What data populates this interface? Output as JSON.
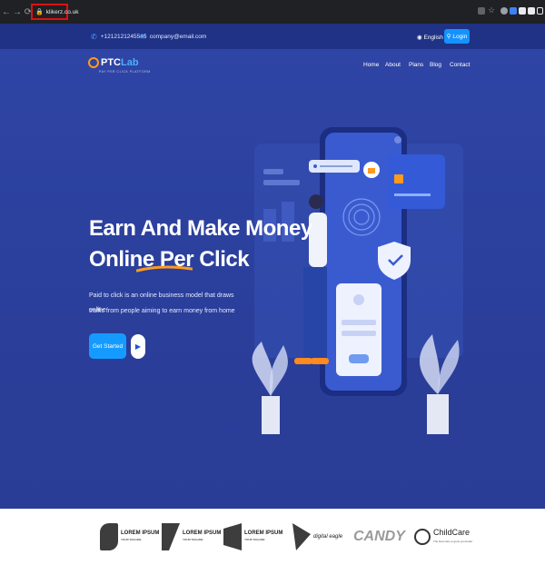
{
  "browser": {
    "url": "klikerz.co.uk",
    "nav_icons": [
      "back-icon",
      "forward-icon",
      "reload-icon"
    ],
    "extension_icons": [
      "share-icon",
      "star-icon",
      "extension-icon",
      "extension-icon",
      "extension-icon",
      "puzzle-icon",
      "sidebar-icon"
    ]
  },
  "topbar": {
    "phone": "+1212121245545",
    "email": "company@email.com",
    "language": "English",
    "login": "Login"
  },
  "header": {
    "logo_text_1": "PTC",
    "logo_text_2": "Lab",
    "logo_tagline": "PAY PER CLICK PLATFORM",
    "nav": [
      "Home",
      "About",
      "Plans",
      "Blog",
      "Contact"
    ]
  },
  "hero": {
    "headline_line1": "Earn And Make Money",
    "headline_line2": "Online Per Click",
    "description_line1": "Paid to click is an online business model that draws online",
    "description_line2": "traffic from people aiming to earn money from home",
    "cta": "Get Started"
  },
  "brands": [
    {
      "name": "LOREM IPSUM",
      "sub": "YOUR TAGLINE"
    },
    {
      "name": "LOREM IPSUM",
      "sub": "YOUR TAGLINE"
    },
    {
      "name": "LOREM IPSUM",
      "sub": "YOUR TAGLINE"
    },
    {
      "name": "digital eagle",
      "sub": ""
    },
    {
      "name": "CANDY",
      "sub": ""
    },
    {
      "name": "ChildCare",
      "sub": "The best care to grow you better"
    }
  ],
  "colors": {
    "hero_bg": "#2b3f9c",
    "topbar_bg": "#1f3286",
    "accent": "#159bff",
    "orange": "#ff9a1f"
  }
}
